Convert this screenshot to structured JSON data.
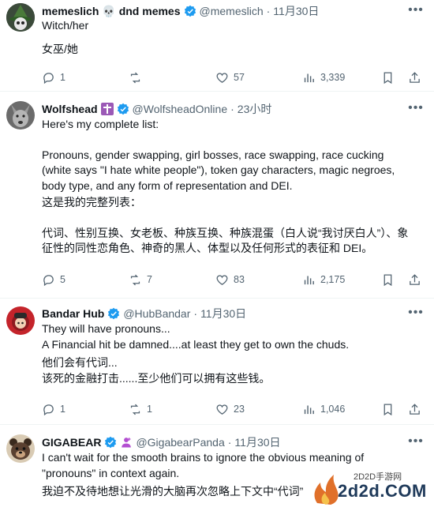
{
  "tweets": [
    {
      "name": "memeslich",
      "name_emoji": "💀 dnd memes",
      "handle": "@memeslich",
      "time": "11月30日",
      "lines": [
        "Witch/her",
        "",
        "女巫/她"
      ],
      "replies": "1",
      "retweets": "",
      "likes": "57",
      "views": "3,339"
    },
    {
      "name": "Wolfshead",
      "handle": "@WolfsheadOnline",
      "time": "23小时",
      "lines": [
        "Here's my complete list:",
        "",
        "Pronouns, gender swapping, girl bosses, race swapping, race cucking",
        "(white says \"I hate white people\"), token gay characters, magic negroes,",
        "body type, and any form of representation and DEI.",
        "这是我的完整列表：",
        "",
        "代词、性别互换、女老板、种族互换、种族混蛋（白人说“我讨厌白人”）、象",
        "征性的同性恋角色、神奇的黑人、体型以及任何形式的表征和 DEI。"
      ],
      "replies": "5",
      "retweets": "7",
      "likes": "83",
      "views": "2,175"
    },
    {
      "name": "Bandar Hub",
      "handle": "@HubBandar",
      "time": "11月30日",
      "lines": [
        "They will have pronouns...",
        "A Financial hit be damned....at least they get to own the chuds.",
        "他们会有代词...",
        "该死的金融打击......至少他们可以拥有这些钱。"
      ],
      "replies": "1",
      "retweets": "1",
      "likes": "23",
      "views": "1,046"
    },
    {
      "name": "GIGABEAR",
      "handle": "@GigabearPanda",
      "time": "11月30日",
      "lines": [
        "I can't wait for the smooth brains to ignore the obvious meaning of",
        "\"pronouns\" in context again.",
        "我迫不及待地想让光滑的大脑再次忽略上下文中“代词”"
      ]
    }
  ],
  "dot": "·",
  "watermark": {
    "site": "2D2D手游网",
    "url": "2d2d.COM"
  },
  "colors": {
    "verified": "#1d9bf0",
    "muted": "#536471",
    "text": "#0f1419",
    "divider": "#eff3f4"
  }
}
